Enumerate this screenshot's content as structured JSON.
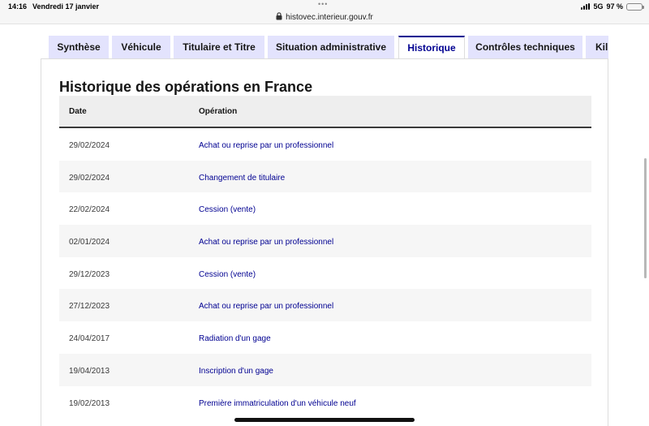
{
  "status_bar": {
    "time": "14:16",
    "date": "Vendredi 17 janvier",
    "url": "histovec.interieur.gouv.fr",
    "network": "5G",
    "battery": "97 %",
    "battery_level": 0.97
  },
  "tabs": [
    {
      "label": "Synthèse",
      "active": false
    },
    {
      "label": "Véhicule",
      "active": false
    },
    {
      "label": "Titulaire et Titre",
      "active": false
    },
    {
      "label": "Situation administrative",
      "active": false
    },
    {
      "label": "Historique",
      "active": true
    },
    {
      "label": "Contrôles techniques",
      "active": false
    },
    {
      "label": "Kil",
      "active": false
    }
  ],
  "section": {
    "title": "Historique des opérations en France",
    "columns": {
      "date": "Date",
      "operation": "Opération"
    },
    "rows": [
      {
        "date": "29/02/2024",
        "operation": "Achat ou reprise par un professionnel"
      },
      {
        "date": "29/02/2024",
        "operation": "Changement de titulaire"
      },
      {
        "date": "22/02/2024",
        "operation": "Cession (vente)"
      },
      {
        "date": "02/01/2024",
        "operation": "Achat ou reprise par un professionnel"
      },
      {
        "date": "29/12/2023",
        "operation": "Cession (vente)"
      },
      {
        "date": "27/12/2023",
        "operation": "Achat ou reprise par un professionnel"
      },
      {
        "date": "24/04/2017",
        "operation": "Radiation d'un gage"
      },
      {
        "date": "19/04/2013",
        "operation": "Inscription d'un gage"
      },
      {
        "date": "19/02/2013",
        "operation": "Première immatriculation d'un véhicule neuf"
      }
    ]
  },
  "colors": {
    "accent": "#000091",
    "tab_background": "#e3e3fd",
    "header_background": "#eeeeee",
    "row_alt": "#f6f6f6"
  }
}
